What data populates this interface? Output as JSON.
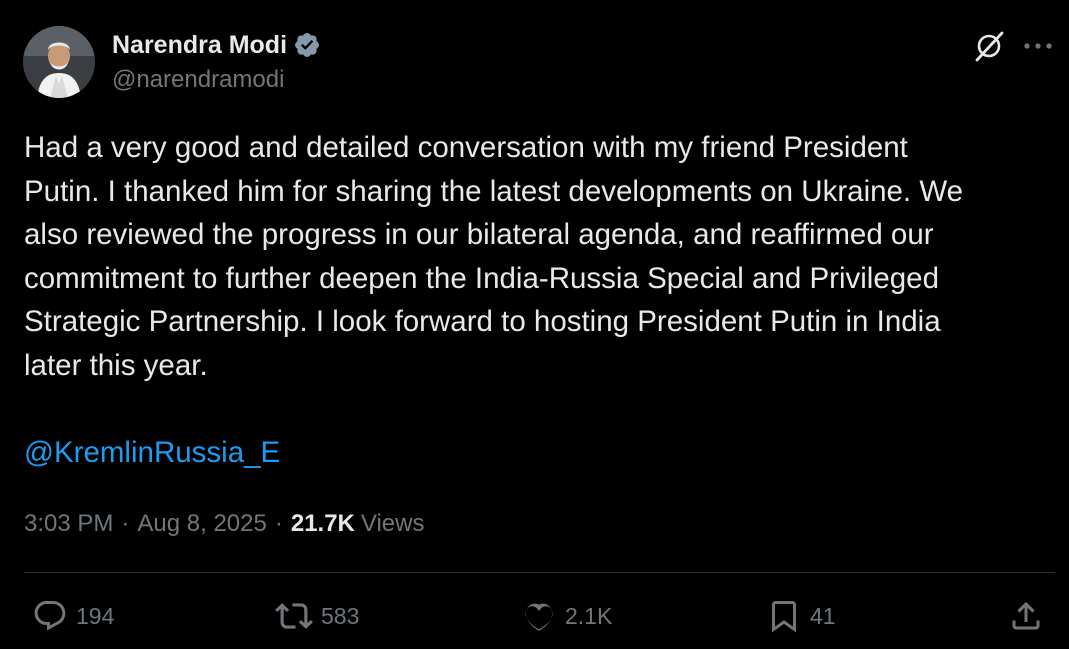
{
  "author": {
    "name": "Narendra Modi",
    "handle": "@narendramodi",
    "verified": true,
    "verified_color": "#829aab"
  },
  "header_icons": {
    "grok": "grok-icon",
    "more": "more-horizontal-icon"
  },
  "tweet": {
    "text": "Had a very good and detailed conversation with my friend President\nPutin. I thanked him for sharing the latest developments on Ukraine. We\nalso reviewed the progress in our bilateral agenda, and reaffirmed our\ncommitment to further deepen the India-Russia Special and Privileged\nStrategic Partnership. I look forward to hosting President Putin in India\nlater this year.",
    "mention": "@KremlinRussia_E"
  },
  "meta": {
    "time": "3:03 PM",
    "separator": "·",
    "date": "Aug 8, 2025",
    "views_count": "21.7K",
    "views_label": "Views"
  },
  "actions": {
    "replies": "194",
    "reposts": "583",
    "likes": "2.1K",
    "bookmarks": "41"
  },
  "colors": {
    "background": "#000000",
    "text": "#e7e9ea",
    "secondary": "#71767b",
    "link": "#1d9bf0",
    "divider": "#2f3336"
  }
}
